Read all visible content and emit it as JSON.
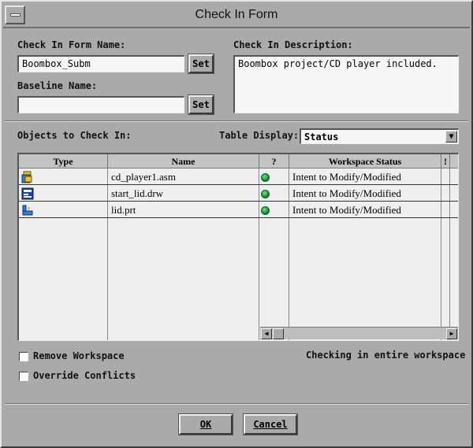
{
  "window": {
    "title": "Check In Form"
  },
  "form": {
    "name_label": "Check In Form Name:",
    "name_value": "Boombox_Subm",
    "baseline_label": "Baseline Name:",
    "baseline_value": "",
    "set_label": "Set",
    "description_label": "Check In Description:",
    "description_value": "Boombox project/CD player included."
  },
  "objects": {
    "label": "Objects to Check In:",
    "table_display_label": "Table Display:",
    "table_display_value": "Status",
    "columns": [
      "Type",
      "Name",
      "?",
      "Workspace Status",
      "!"
    ],
    "rows": [
      {
        "type_icon": "assembly-icon",
        "name": "cd_player1.asm",
        "status_icon": "green-status-icon",
        "workspace_status": "Intent to Modify/Modified"
      },
      {
        "type_icon": "drawing-icon",
        "name": "start_lid.drw",
        "status_icon": "green-status-icon",
        "workspace_status": "Intent to Modify/Modified"
      },
      {
        "type_icon": "part-icon",
        "name": "lid.prt",
        "status_icon": "green-status-icon",
        "workspace_status": "Intent to Modify/Modified"
      }
    ]
  },
  "options": {
    "remove_workspace": {
      "label": "Remove Workspace",
      "checked": false
    },
    "override_conflicts": {
      "label": "Override Conflicts",
      "checked": false
    },
    "status_text": "Checking in entire workspace"
  },
  "footer": {
    "ok_label": "OK",
    "cancel_label": "Cancel"
  },
  "colors": {
    "window_bg": "#aaaaaa",
    "field_bg": "#f7f7f7",
    "status_green": "#1a9a2a"
  }
}
